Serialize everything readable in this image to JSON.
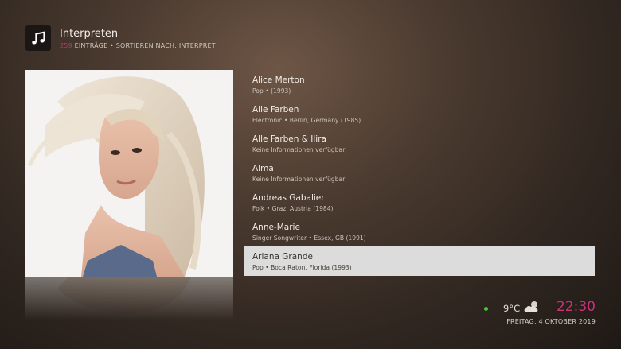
{
  "header": {
    "icon": "music-note-icon",
    "title": "Interpreten",
    "count": "259",
    "subtitle_rest": " EINTRÄGE  •  SORTIEREN NACH: INTERPRET"
  },
  "artwork": {
    "alt": "Ariana Grande"
  },
  "artists": [
    {
      "name": "Alice Merton",
      "meta": "Pop  •  (1993)",
      "selected": false
    },
    {
      "name": "Alle Farben",
      "meta": "Electronic  •  Berlin, Germany (1985)",
      "selected": false
    },
    {
      "name": "Alle Farben & Ilira",
      "meta": "Keine Informationen verfügbar",
      "selected": false
    },
    {
      "name": "Alma",
      "meta": "Keine Informationen verfügbar",
      "selected": false
    },
    {
      "name": "Andreas Gabalier",
      "meta": "Folk  •  Graz, Austria (1984)",
      "selected": false
    },
    {
      "name": "Anne-Marie",
      "meta": "Singer Songwriter  •  Essex,  GB (1991)",
      "selected": false
    },
    {
      "name": "Ariana Grande",
      "meta": "Pop  •  Boca Raton, Florida (1993)",
      "selected": true
    }
  ],
  "status": {
    "temperature": "9°C",
    "weather_icon": "partly-cloudy-icon",
    "time": "22:30",
    "date": "FREITAG, 4 OKTOBER 2019",
    "indicator_color": "#46c83c",
    "accent_color": "#c9317a"
  }
}
